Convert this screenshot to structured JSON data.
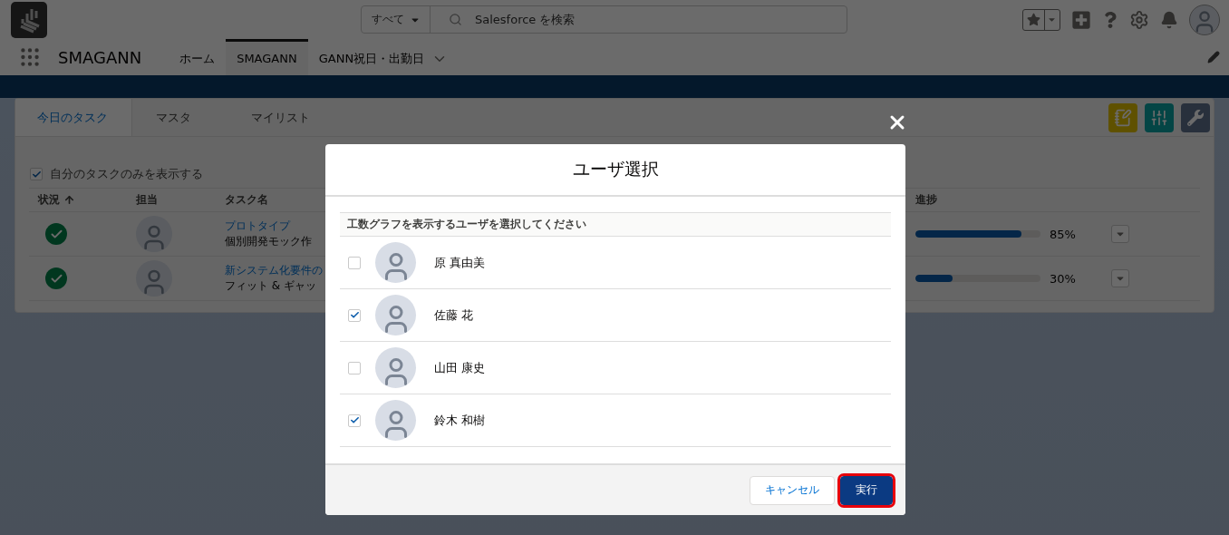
{
  "header": {
    "search_scope": "すべて",
    "search_placeholder": "Salesforce を検索"
  },
  "nav": {
    "app_name": "SMAGANN",
    "tabs": [
      {
        "label": "ホーム",
        "selected": false,
        "dropdown": false
      },
      {
        "label": "SMAGANN",
        "selected": true,
        "dropdown": false
      },
      {
        "label": "GANN祝日・出勤日",
        "selected": false,
        "dropdown": true
      }
    ]
  },
  "card": {
    "tabs": [
      {
        "label": "今日のタスク",
        "selected": true
      },
      {
        "label": "マスタ",
        "selected": false
      },
      {
        "label": "マイリスト",
        "selected": false
      }
    ],
    "filter": {
      "label": "自分のタスクのみを表示する",
      "checked": true
    },
    "columns": [
      {
        "label": "状況",
        "sorted": true
      },
      {
        "label": "担当",
        "sorted": false
      },
      {
        "label": "タスク名",
        "sorted": false
      },
      {
        "label": "進捗",
        "sorted": false
      }
    ],
    "rows": [
      {
        "kind": "complete",
        "task_link": "プロトタイプ",
        "task_name": "個別開発モック作",
        "level": 0.85,
        "reading": "85%"
      },
      {
        "kind": "complete",
        "task_link": "新システム化要件の",
        "task_name": "フィット & ギャッ",
        "level": 0.3,
        "reading": "30%"
      }
    ]
  },
  "modal": {
    "title": "ユーザ選択",
    "instruction": "工数グラフを表示するユーザを選択してください",
    "users": [
      {
        "name": "原 真由美",
        "checked": false
      },
      {
        "name": "佐藤 花",
        "checked": true
      },
      {
        "name": "山田 康史",
        "checked": false
      },
      {
        "name": "鈴木 和樹",
        "checked": true
      }
    ],
    "buttons": [
      {
        "label": "キャンセル",
        "kind": "neutral",
        "highlighted": false
      },
      {
        "label": "実行",
        "kind": "brand",
        "highlighted": true
      }
    ]
  }
}
